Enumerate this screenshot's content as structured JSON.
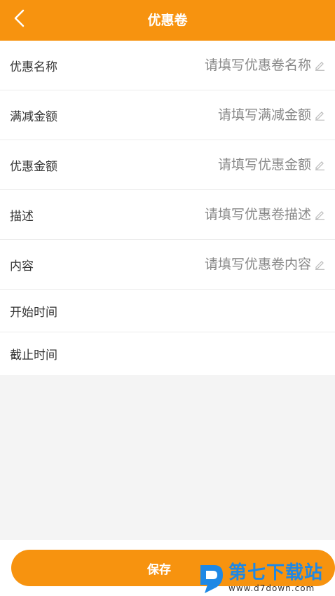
{
  "header": {
    "title": "优惠卷",
    "back_icon": "chevron-left-icon"
  },
  "form": {
    "fields": [
      {
        "label": "优惠名称",
        "placeholder": "请填写优惠卷名称"
      },
      {
        "label": "满减金额",
        "placeholder": "请填写满减金额"
      },
      {
        "label": "优惠金额",
        "placeholder": "请填写优惠金额"
      },
      {
        "label": "描述",
        "placeholder": "请填写优惠卷描述"
      },
      {
        "label": "内容",
        "placeholder": "请填写优惠卷内容"
      }
    ],
    "start_time_label": "开始时间",
    "end_time_label": "截止时间"
  },
  "footer": {
    "save_label": "保存"
  },
  "watermark": {
    "text": "第七下载站",
    "url": "www.d7down.com"
  },
  "colors": {
    "accent": "#f7930f",
    "background": "#f4f4f4",
    "watermark": "#1e88e5"
  }
}
